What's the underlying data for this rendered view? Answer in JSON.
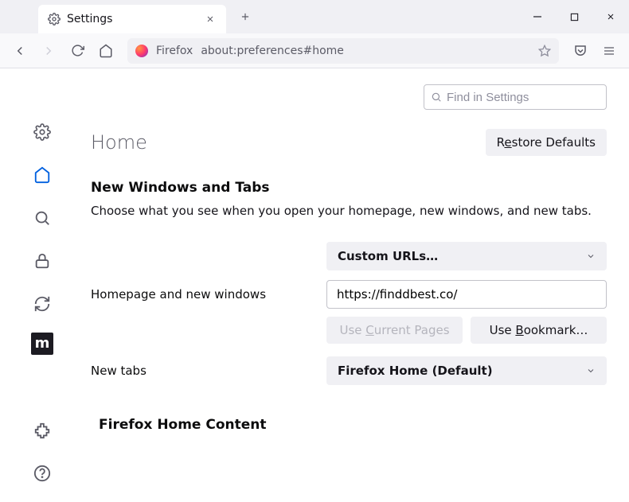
{
  "tab": {
    "title": "Settings"
  },
  "urlbar": {
    "prefix": "Firefox",
    "address": "about:preferences#home"
  },
  "search": {
    "placeholder": "Find in Settings"
  },
  "page": {
    "title": "Home"
  },
  "buttons": {
    "restoreDefaults_pre": "R",
    "restoreDefaults_u": "e",
    "restoreDefaults_post": "store Defaults",
    "useCurrent_pre": "Use ",
    "useCurrent_u": "C",
    "useCurrent_post": "urrent Pages",
    "useBookmark_pre": "Use ",
    "useBookmark_u": "B",
    "useBookmark_post": "ookmark…"
  },
  "section": {
    "newWindowsTitle": "New Windows and Tabs",
    "newWindowsSub": "Choose what you see when you open your homepage, new windows, and new tabs."
  },
  "homepage": {
    "label": "Homepage and new windows",
    "selectValue": "Custom URLs…",
    "urlValue": "https://finddbest.co/"
  },
  "newtabs": {
    "label": "New tabs",
    "selectValue": "Firefox Home (Default)"
  },
  "section2": {
    "title": "Firefox Home Content"
  },
  "extIcon": {
    "letter": "m"
  }
}
